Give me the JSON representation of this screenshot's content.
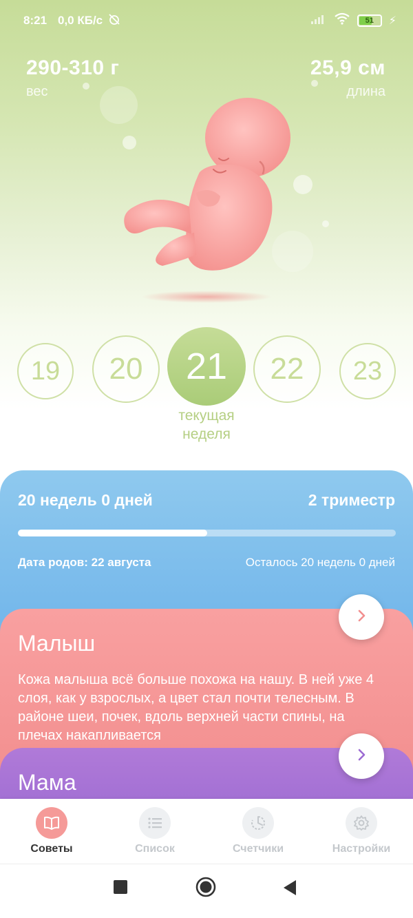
{
  "status_bar": {
    "time": "8:21",
    "speed": "0,0 КБ/с",
    "battery": "51"
  },
  "metrics": {
    "weight_value": "290-310 г",
    "weight_label": "вес",
    "length_value": "25,9 см",
    "length_label": "длина"
  },
  "weeks": {
    "items": [
      "19",
      "20",
      "21",
      "22",
      "23"
    ],
    "current": "21",
    "current_label_line1": "текущая",
    "current_label_line2": "неделя"
  },
  "progress": {
    "elapsed": "20 недель 0 дней",
    "trimester": "2 триместр",
    "fraction": 0.5,
    "due_date": "Дата родов: 22 августа",
    "remaining": "Осталось 20 недель 0 дней"
  },
  "baby_card": {
    "title": "Малыш",
    "text": "Кожа малыша всё больше похожа на нашу. В ней уже 4 слоя, как у взрослых, а цвет стал почти телесным. В районе шеи, почек, вдоль верхней части спины, на плечах накапливается"
  },
  "mom_card": {
    "title": "Мама"
  },
  "bottom_nav": {
    "items": [
      {
        "label": "Советы",
        "icon": "book-icon",
        "active": true
      },
      {
        "label": "Список",
        "icon": "list-icon",
        "active": false
      },
      {
        "label": "Счетчики",
        "icon": "timer-icon",
        "active": false
      },
      {
        "label": "Настройки",
        "icon": "gear-icon",
        "active": false
      }
    ]
  },
  "colors": {
    "hero_green": "#c6dc98",
    "week_green": "#aacc78",
    "progress_blue": "#6fb4ea",
    "baby_pink": "#f28f8f",
    "mom_purple": "#9c6bd2",
    "nav_active": "#f59a98"
  }
}
